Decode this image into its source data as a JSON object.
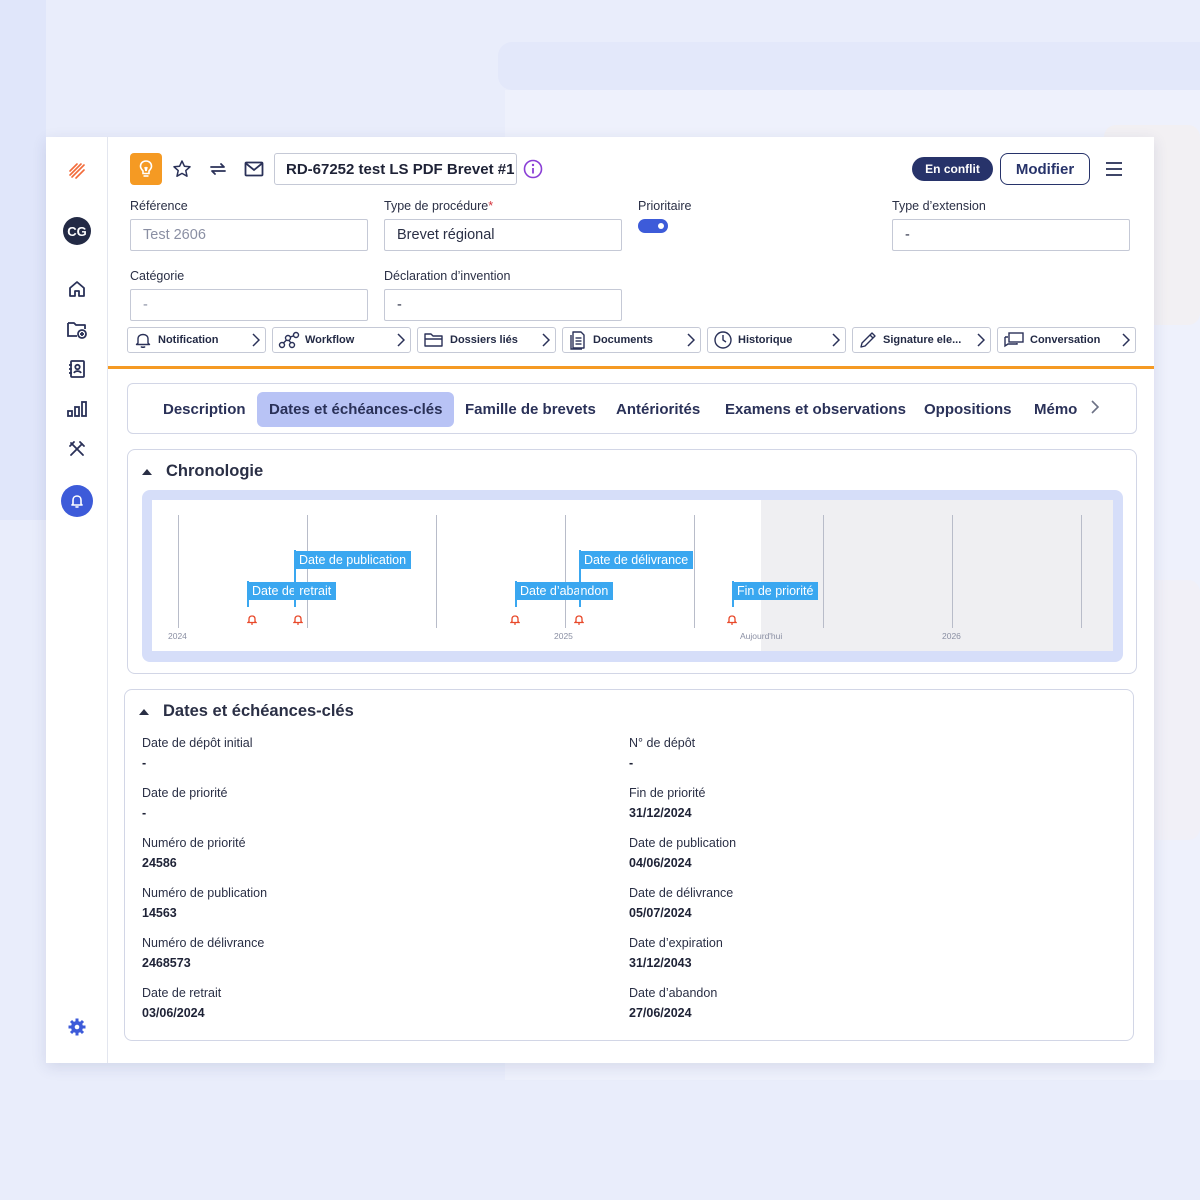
{
  "header": {
    "title": "RD-67252 test LS PDF Brevet #1",
    "status_badge": "En conflit",
    "modify_label": "Modifier"
  },
  "sidebar": {
    "avatar_initials": "CG",
    "icons": [
      "logo-icon",
      "home-icon",
      "folder-add-icon",
      "contacts-icon",
      "bar-chart-icon",
      "tools-icon",
      "bell-icon",
      "settings-icon"
    ]
  },
  "fields": {
    "reference": {
      "label": "Référence",
      "value": "Test 2606"
    },
    "procedure_type": {
      "label": "Type de procédure",
      "required_mark": "*",
      "value": "Brevet régional"
    },
    "priority": {
      "label": "Prioritaire",
      "on": true
    },
    "extension_type": {
      "label": "Type d’extension",
      "value": "-"
    },
    "category": {
      "label": "Catégorie",
      "value": "-"
    },
    "invention_declaration": {
      "label": "Déclaration d’invention",
      "value": "-"
    }
  },
  "actions": [
    {
      "label": "Notification",
      "icon": "bell-outline-icon"
    },
    {
      "label": "Workflow",
      "icon": "workflow-icon"
    },
    {
      "label": "Dossiers liés",
      "icon": "folder-outline-icon"
    },
    {
      "label": "Documents",
      "icon": "document-icon"
    },
    {
      "label": "Historique",
      "icon": "clock-icon"
    },
    {
      "label": "Signature ele...",
      "icon": "pen-icon"
    },
    {
      "label": "Conversation",
      "icon": "chat-icon"
    }
  ],
  "tabs": [
    {
      "label": "Description",
      "active": false
    },
    {
      "label": "Dates et échéances-clés",
      "active": true
    },
    {
      "label": "Famille de brevets",
      "active": false
    },
    {
      "label": "Antériorités",
      "active": false
    },
    {
      "label": "Examens et observations",
      "active": false
    },
    {
      "label": "Oppositions",
      "active": false
    },
    {
      "label": "Mémo",
      "active": false
    }
  ],
  "chronology": {
    "title": "Chronologie",
    "axis_labels": {
      "y2024": "2024",
      "y2025": "2025",
      "today": "Aujourd'hui",
      "y2026": "2026"
    },
    "events": [
      {
        "label": "Date de retrait",
        "date": "2024-06-03"
      },
      {
        "label": "Date de publication",
        "date": "2024-06-04"
      },
      {
        "label": "Date d’abandon",
        "date": "2024-06-27"
      },
      {
        "label": "Date de délivrance",
        "date": "2024-07-05"
      },
      {
        "label": "Fin de priorité",
        "date": "2024-12-31"
      }
    ],
    "colors": {
      "label": "#3aa7f0",
      "bell": "#e8492a"
    }
  },
  "dates_section": {
    "title": "Dates et échéances-clés",
    "left": [
      {
        "label": "Date de dépôt initial",
        "value": "-"
      },
      {
        "label": "Date de priorité",
        "value": "-"
      },
      {
        "label": "Numéro de priorité",
        "value": "24586"
      },
      {
        "label": "Numéro de publication",
        "value": "14563"
      },
      {
        "label": "Numéro de délivrance",
        "value": "2468573"
      },
      {
        "label": "Date de retrait",
        "value": "03/06/2024"
      }
    ],
    "right": [
      {
        "label": "N° de dépôt",
        "value": "-"
      },
      {
        "label": "Fin de priorité",
        "value": "31/12/2024"
      },
      {
        "label": "Date de publication",
        "value": "04/06/2024"
      },
      {
        "label": "Date de délivrance",
        "value": "05/07/2024"
      },
      {
        "label": "Date d’expiration",
        "value": "31/12/2043"
      },
      {
        "label": "Date d’abandon",
        "value": "27/06/2024"
      }
    ]
  },
  "colors": {
    "accent": "#f59a23",
    "primary": "#27336a",
    "blue": "#3d5bd9",
    "tab_active": "#b8c3f5"
  }
}
